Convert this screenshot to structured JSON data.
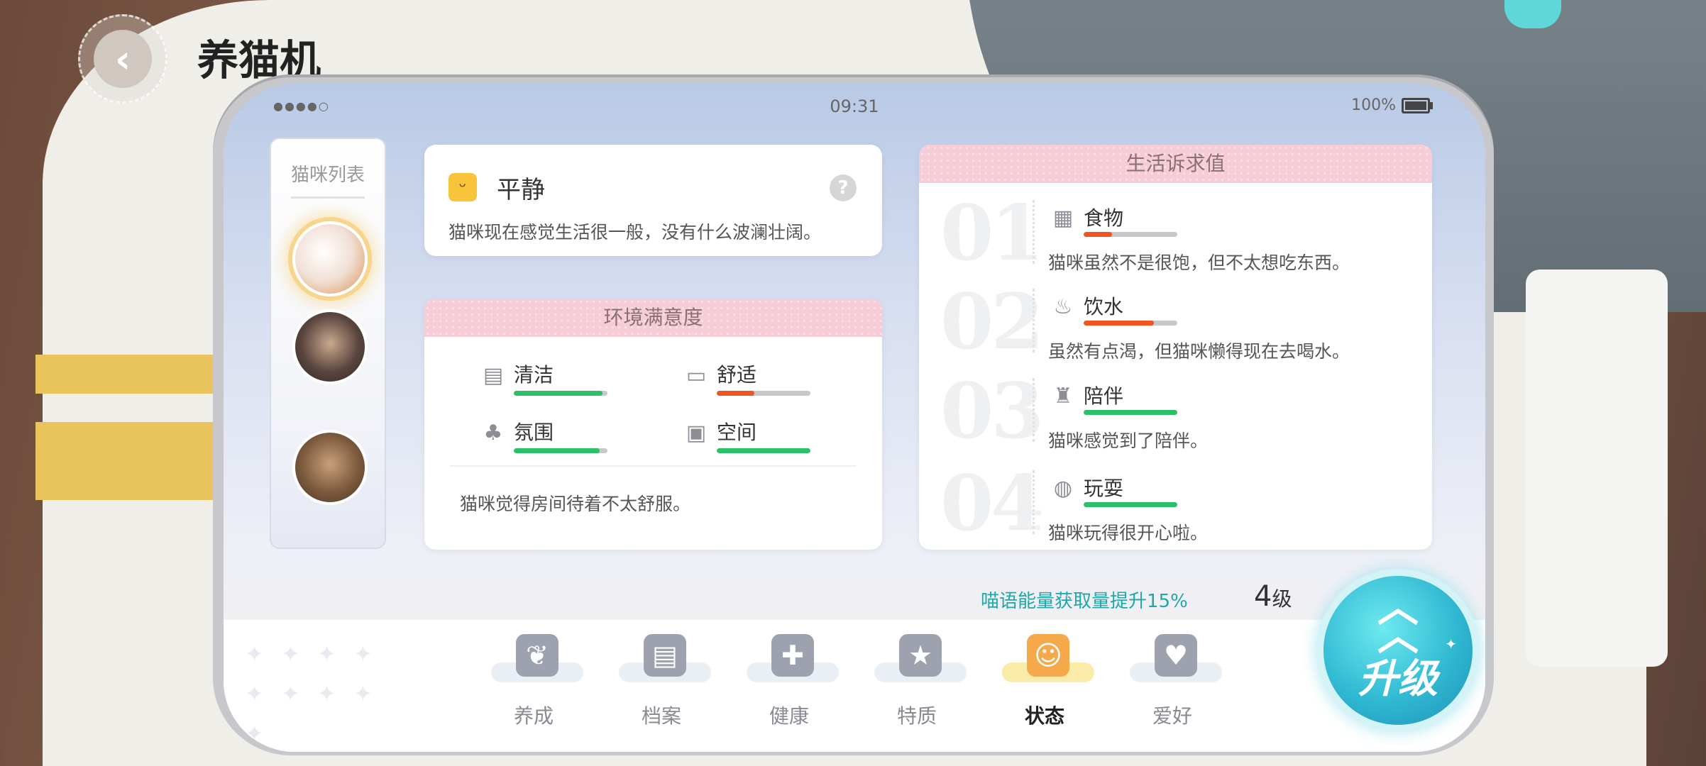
{
  "header": {
    "title": "养猫机",
    "back_icon": "back-arrow-icon"
  },
  "status_bar": {
    "dots": "●●●●○",
    "time": "09:31",
    "battery": "100%"
  },
  "cat_list": {
    "title": "猫咪列表",
    "cats": [
      {
        "icon": "calico-cat-avatar",
        "selected": true
      },
      {
        "icon": "siamese-cat-avatar",
        "selected": false
      },
      {
        "icon": "tabby-cat-avatar",
        "selected": false
      }
    ]
  },
  "mood": {
    "title": "平静",
    "description": "猫咪现在感觉生活很一般，没有什么波澜壮阔。",
    "help": "?"
  },
  "environment": {
    "title": "环境满意度",
    "items": [
      {
        "label": "清洁",
        "value": 0.95,
        "color": "#2bc067"
      },
      {
        "label": "舒适",
        "value": 0.4,
        "color": "#ee5521"
      },
      {
        "label": "氛围",
        "value": 0.92,
        "color": "#2bc067"
      },
      {
        "label": "空间",
        "value": 1.0,
        "color": "#2bc067"
      }
    ],
    "description": "猫咪觉得房间待着不太舒服。"
  },
  "needs": {
    "title": "生活诉求值",
    "items": [
      {
        "num": "01",
        "label": "食物",
        "value": 0.3,
        "color": "#ee5521",
        "description": "猫咪虽然不是很饱，但不太想吃东西。"
      },
      {
        "num": "02",
        "label": "饮水",
        "value": 0.75,
        "color": "#ee5521",
        "description": "虽然有点渴，但猫咪懒得现在去喝水。"
      },
      {
        "num": "03",
        "label": "陪伴",
        "value": 1.0,
        "color": "#2bc067",
        "description": "猫咪感觉到了陪伴。"
      },
      {
        "num": "04",
        "label": "玩耍",
        "value": 1.0,
        "color": "#2bc067",
        "description": "猫咪玩得很开心啦。"
      }
    ]
  },
  "bonus": "喵语能量获取量提升15%",
  "level": {
    "value": "4",
    "unit": "级"
  },
  "tabs": [
    {
      "label": "养成",
      "icon": "nurture-icon",
      "active": false
    },
    {
      "label": "档案",
      "icon": "archive-icon",
      "active": false
    },
    {
      "label": "健康",
      "icon": "medkit-icon",
      "active": false
    },
    {
      "label": "特质",
      "icon": "star-badge-icon",
      "active": false
    },
    {
      "label": "状态",
      "icon": "status-face-icon",
      "active": true
    },
    {
      "label": "爱好",
      "icon": "heart-bubble-icon",
      "active": false
    }
  ],
  "upgrade": {
    "label": "升级"
  }
}
